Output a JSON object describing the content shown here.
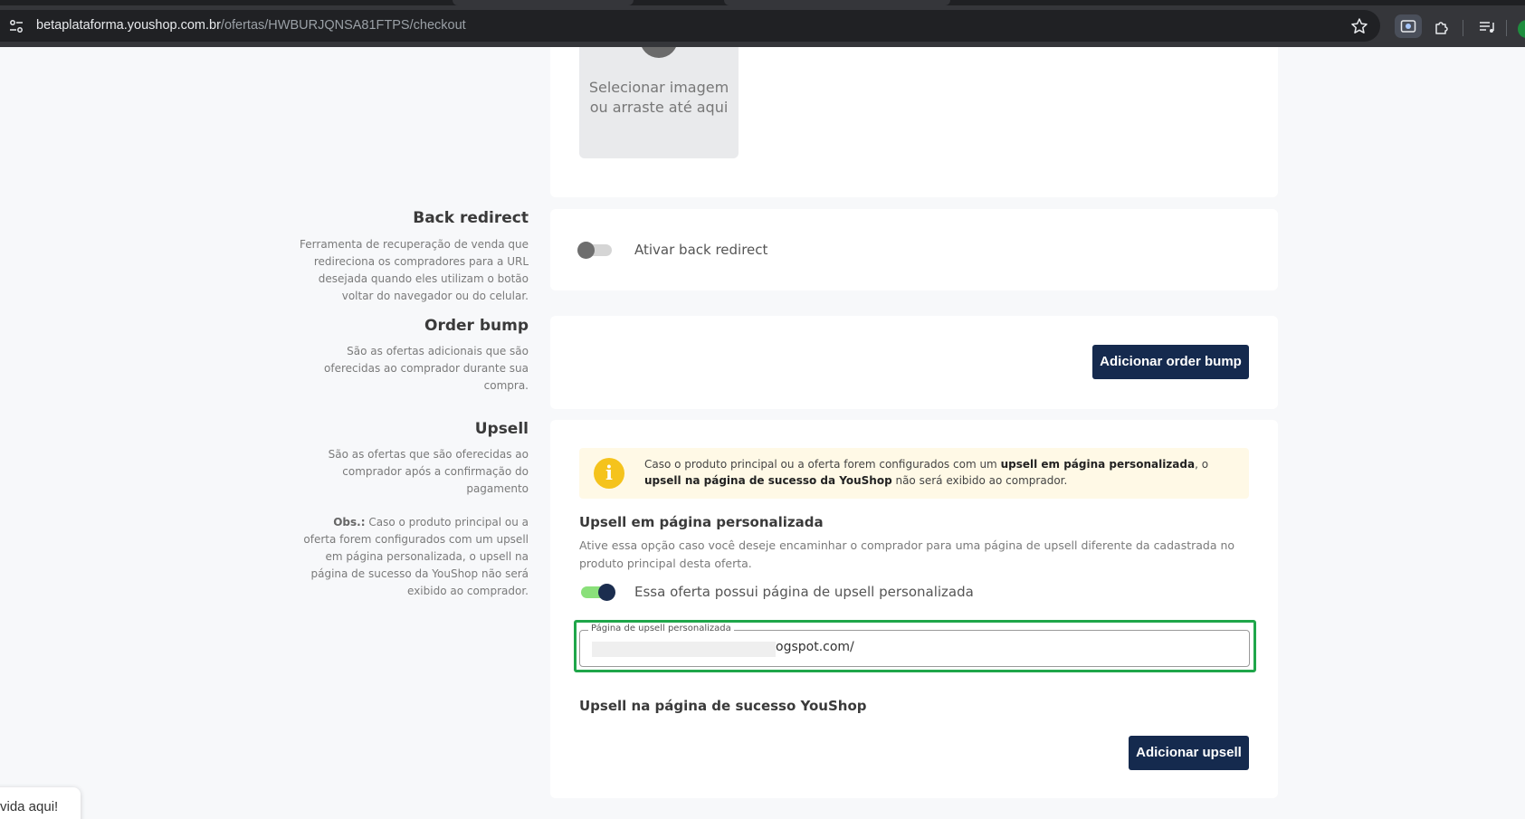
{
  "browser": {
    "url_domain": "betaplataforma.youshop.com.br",
    "url_path": "/ofertas/HWBURJQNSA81FTPS/checkout"
  },
  "image_upload": {
    "text": "Selecionar imagem ou arraste até aqui"
  },
  "back_redirect": {
    "title": "Back redirect",
    "description": "Ferramenta de recuperação de venda que redireciona os compradores para a URL desejada quando eles utilizam o botão voltar do navegador ou do celular.",
    "toggle_label": "Ativar back redirect",
    "enabled": false
  },
  "order_bump": {
    "title": "Order bump",
    "description": "São as ofertas adicionais que são oferecidas ao comprador durante sua compra.",
    "button_label": "Adicionar order bump"
  },
  "upsell": {
    "title": "Upsell",
    "description": "São as ofertas que são oferecidas ao comprador após a confirmação do pagamento",
    "obs_label": "Obs.:",
    "obs_text": " Caso o produto principal ou a oferta forem configurados com um upsell em página personalizada, o upsell na página de sucesso da YouShop não será exibido ao comprador.",
    "alert": {
      "icon": "info-icon",
      "text_1": "Caso o produto principal ou a oferta forem configurados com um ",
      "bold_1": "upsell em página personalizada",
      "text_2": ", o ",
      "bold_2": "upsell na página de sucesso da YouShop",
      "text_3": " não será exibido ao comprador."
    },
    "custom_page": {
      "title": "Upsell em página personalizada",
      "description": "Ative essa opção caso você deseje encaminhar o comprador para uma página de upsell diferente da cadastrada no produto principal desta oferta.",
      "toggle_label": "Essa oferta possui página de upsell personalizada",
      "enabled": true,
      "field_label": "Página de upsell personalizada",
      "field_value": "ogspot.com/"
    },
    "success_page": {
      "title": "Upsell na página de sucesso YouShop",
      "button_label": "Adicionar upsell"
    }
  },
  "help_widget": {
    "text": "vida aqui!"
  },
  "colors": {
    "navy": "#152a4e",
    "toggle_on": "#8ae07a",
    "alert_bg": "#fff9e6",
    "alert_icon": "#f5c31c",
    "highlight": "#1fa64a"
  }
}
